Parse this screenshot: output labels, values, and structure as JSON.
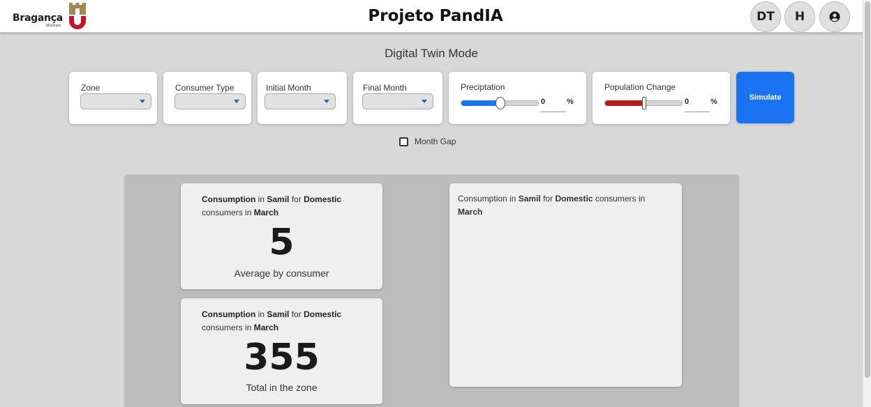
{
  "header": {
    "logo_text": "Bragança",
    "logo_sub": "Município",
    "title": "Projeto PandIA",
    "buttons": {
      "dt": "DT",
      "h": "H"
    }
  },
  "mode_title": "Digital Twin Mode",
  "filters": {
    "zone_label": "Zone",
    "consumer_type_label": "Consumer Type",
    "initial_month_label": "Initial Month",
    "final_month_label": "Final Month",
    "precipitation": {
      "label": "Preciptation",
      "value": "0",
      "unit": "%",
      "fraction": 0.5
    },
    "population": {
      "label": "Population Change",
      "value": "0",
      "unit": "%",
      "fraction": 0.5
    },
    "simulate_label": "Simulate",
    "month_gap_label": "Month Gap"
  },
  "colors": {
    "accent": "#1a73f0",
    "population": "#b71c1c"
  },
  "results": {
    "avg_card": {
      "w1": "Consumption",
      "w2": "in",
      "zone": "Samil",
      "w3": "for",
      "type": "Domestic",
      "w4": "consumers in",
      "month": "March",
      "value": "5",
      "caption": "Average by consumer"
    },
    "total_card": {
      "w1": "Consumption",
      "w2": "in",
      "zone": "Samil",
      "w3": "for",
      "type": "Domestic",
      "w4": "consumers in",
      "month": "March",
      "value": "355",
      "caption": "Total in the zone"
    },
    "chart_card": {
      "w1": "Consumption in",
      "zone": "Samil",
      "w3": "for",
      "type": "Domestic",
      "w4": "consumers in",
      "month": "March"
    }
  }
}
